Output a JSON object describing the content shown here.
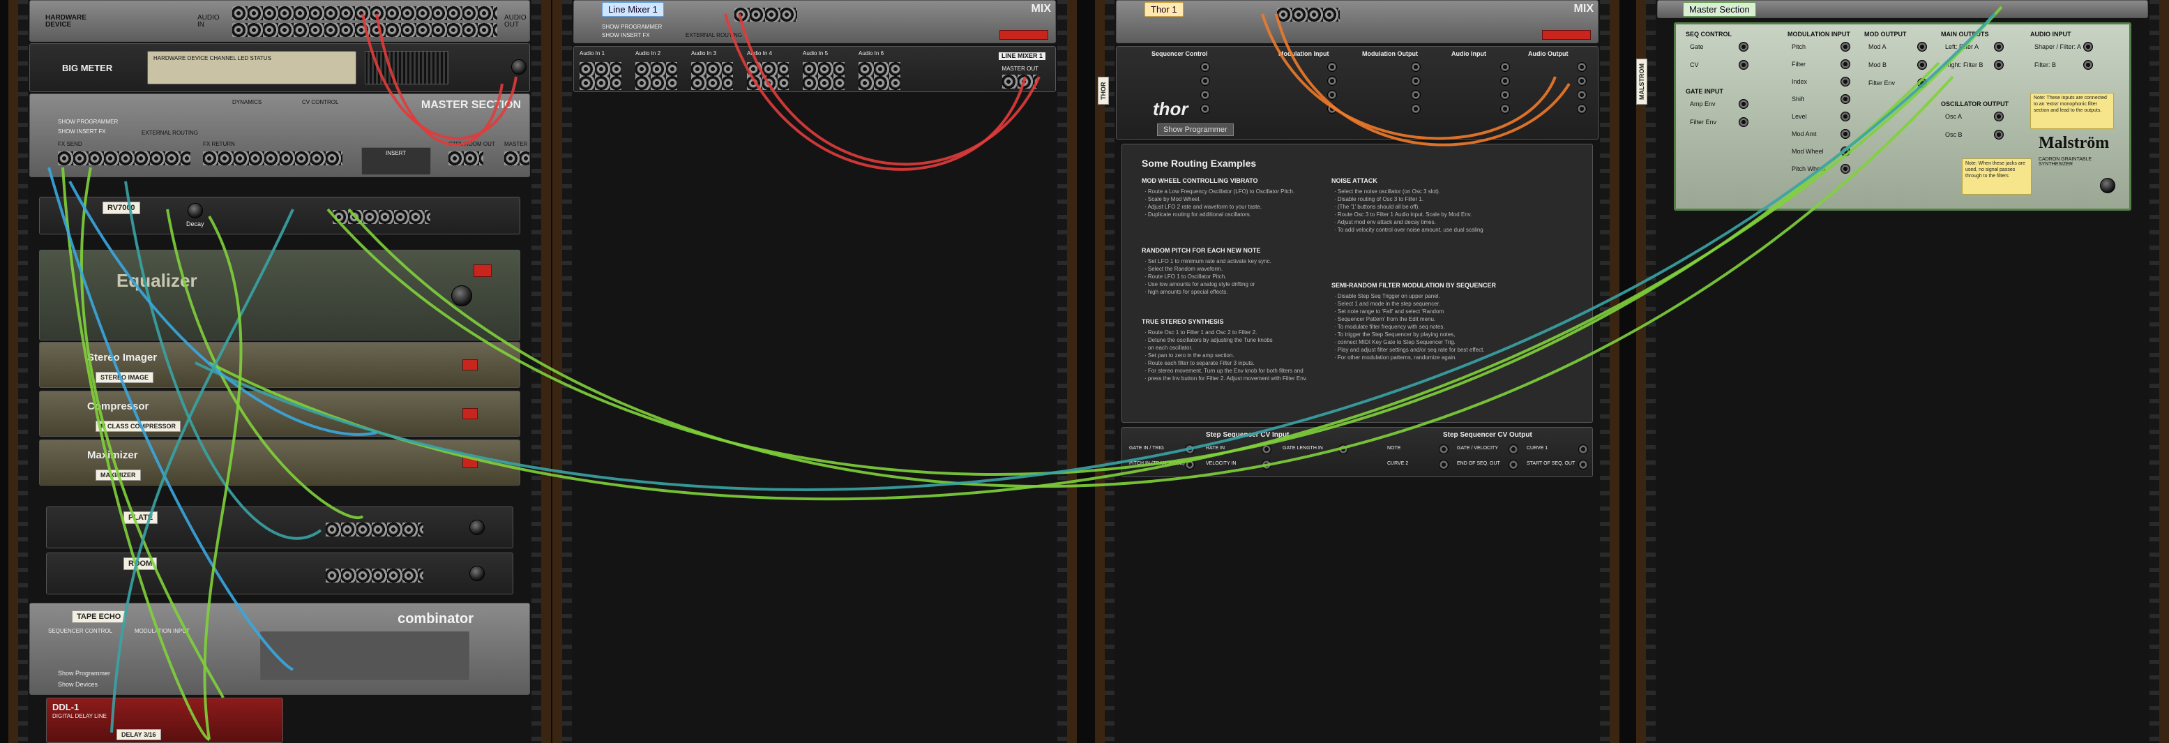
{
  "rack1": {
    "hardware_device": "HARDWARE\nDEVICE",
    "audio_in": "AUDIO\nIN",
    "audio_out": "AUDIO\nOUT",
    "big_meter": "BIG METER",
    "big_meter_note": "HARDWARE DEVICE CHANNEL LED STATUS",
    "master_section": "MASTER SECTION",
    "show_programmer": "SHOW PROGRAMMER",
    "show_insert_fx": "SHOW INSERT FX",
    "external_routing": "EXTERNAL ROUTING",
    "dynamics": "DYNAMICS",
    "cv_control": "CV CONTROL",
    "fx_send": "FX SEND",
    "fx_return": "FX RETURN",
    "ctrl_room_out": "CTRL ROOM OUT",
    "master_out": "MASTER OUT",
    "insert": "INSERT",
    "devices": [
      {
        "name": "RV7000",
        "tag": "",
        "tags_extra": "Decay"
      },
      {
        "name": "Equalizer",
        "tag": "",
        "tags_extra": ""
      },
      {
        "name": "Stereo Imager",
        "tag": "STEREO IMAGE",
        "tags_extra": ""
      },
      {
        "name": "Compressor",
        "tag": "M CLASS COMPRESSOR",
        "tags_extra": ""
      },
      {
        "name": "Maximizer",
        "tag": "MAXIMIZER",
        "tags_extra": ""
      }
    ],
    "plate": "PLATE",
    "room": "ROOM",
    "tape_echo": "TAPE ECHO",
    "combinator": "combinator",
    "sequencer_control": "SEQUENCER CONTROL",
    "modulation_input": "MODULATION INPUT",
    "show_programmer2": "Show Programmer",
    "show_devices": "Show Devices",
    "ddl": "DDL-1",
    "ddl_sub": "DIGITAL DELAY LINE",
    "delay_tag": "DELAY 3/16"
  },
  "rack2": {
    "mixer_name": "Line Mixer 1",
    "mix": "MIX",
    "show_programmer": "SHOW PROGRAMMER",
    "show_insert_fx": "SHOW INSERT FX",
    "external_routing": "EXTERNAL ROUTING",
    "tag_label": "LINE MIXER 1",
    "master_out": "MASTER OUT",
    "channels": [
      "Audio In 1",
      "Audio In 2",
      "Audio In 3",
      "Audio In 4",
      "Audio In 5",
      "Audio In 6"
    ]
  },
  "rack3": {
    "thor_name": "Thor 1",
    "mix": "MIX",
    "master_tag": "Master Section",
    "thor_logo": "thor",
    "show_programmer": "Show Programmer",
    "sections": [
      "Sequencer Control",
      "Modulation Input",
      "Modulation Output",
      "Audio Input",
      "Audio Output"
    ],
    "routing_title": "Some Routing Examples",
    "examples": [
      {
        "title": "MOD WHEEL CONTROLLING VIBRATO",
        "lines": [
          "Route a Low Frequency Oscillator (LFO) to Oscillator Pitch.",
          "Scale by Mod Wheel.",
          "Adjust LFO 2 rate and waveform to your taste.",
          "Duplicate routing for additional oscillators."
        ]
      },
      {
        "title": "RANDOM PITCH FOR EACH NEW NOTE",
        "lines": [
          "Set LFO 1 to minimum rate and activate key sync.",
          "Select the Random waveform.",
          "Route LFO 1 to Oscillator Pitch.",
          "Use low amounts for analog style drifting or",
          "high amounts for special effects."
        ]
      },
      {
        "title": "TRUE STEREO SYNTHESIS",
        "lines": [
          "Route Osc 1 to Filter 1 and Osc 2 to Filter 2.",
          "Detune the oscillators by adjusting the Tune knobs",
          "on each oscillator.",
          "Set pan to zero in the amp section.",
          "Route each filter to separate Filter 3 inputs.",
          "For stereo movement, Turn up the Env knob for both filters and",
          "press the Inv button for Filter 2. Adjust movement with Filter Env."
        ]
      },
      {
        "title": "NOISE ATTACK",
        "lines": [
          "Select the noise oscillator (on Osc 3 slot).",
          "Disable routing of Osc 3 to Filter 1.",
          "(The '1' buttons should all be off).",
          "Route Osc 3 to Filter 1 Audio input. Scale by Mod Env.",
          "Adjust mod env attack and decay times.",
          "To add velocity control over noise amount, use dual scaling"
        ]
      },
      {
        "title": "SEMI-RANDOM FILTER MODULATION BY SEQUENCER",
        "lines": [
          "Disable Step Seq Trigger on upper panel.",
          "Select 1 and mode in the step sequencer.",
          "Set note range to 'Fall' and select 'Random",
          "Sequencer Pattern' from the Edit menu.",
          "To modulate filter frequency with seq notes.",
          "To trigger the Step Sequencer by playing notes,",
          "connect MIDI Key Gate to Step Sequencer Trig.",
          "Play and adjust filter settings and/or seq rate for best effect.",
          "For other modulation patterns, randomize again."
        ]
      }
    ],
    "step_cv_input": "Step Sequencer CV Input",
    "step_cv_output": "Step Sequencer CV Output",
    "step_in_labels": [
      "GATE IN / TRIG",
      "RATE IN",
      "GATE LENGTH IN",
      "PITCH IN (TRANSPOSE)",
      "VELOCITY IN"
    ],
    "step_out_labels": [
      "NOTE",
      "GATE / VELOCITY",
      "CURVE 1",
      "CURVE 2",
      "END OF SEQ. OUT",
      "START OF SEQ. OUT"
    ]
  },
  "rack4": {
    "master_tag": "Master Section",
    "seq_control": "SEQ CONTROL",
    "gate_input": "GATE INPUT",
    "modulation_input": "MODULATION INPUT",
    "mod_output": "MOD OUTPUT",
    "main_outputs": "MAIN OUTPUTS",
    "audio_input": "AUDIO INPUT",
    "oscillator_output": "OSCILLATOR OUTPUT",
    "seq_labels": [
      "Gate",
      "CV"
    ],
    "gate_labels": [
      "Amp Env",
      "Filter Env"
    ],
    "mod_in_labels": [
      "Pitch",
      "Filter",
      "Index",
      "Shift",
      "Level",
      "Mod Amt",
      "Mod Wheel",
      "Pitch Wheel"
    ],
    "mod_out_labels": [
      "Mod A",
      "Mod B",
      "Filter Env"
    ],
    "main_labels": [
      "Left: Filter A",
      "Right: Filter B"
    ],
    "audio_in_labels": [
      "Shaper / Filter: A",
      "Filter: B"
    ],
    "osc_labels": [
      "Osc A",
      "Osc B"
    ],
    "note1": "Note: These inputs are connected to an 'extra' monophonic filter section and lead to the outputs.",
    "note2": "Note: When these jacks are used, no signal passes through to the filters",
    "logo": "Malström",
    "logo_sub": "CADRON GRAINTABLE SYNTHESIZER"
  },
  "vertical_tags": [
    "MALSTROM",
    "THOR"
  ],
  "colors": {
    "cable_red": "#e23b3b",
    "cable_orange": "#f07a2a",
    "cable_green": "#7fd13b",
    "cable_teal": "#38a3a5",
    "cable_blue": "#3aa7e0",
    "wood": "#3a2412"
  }
}
